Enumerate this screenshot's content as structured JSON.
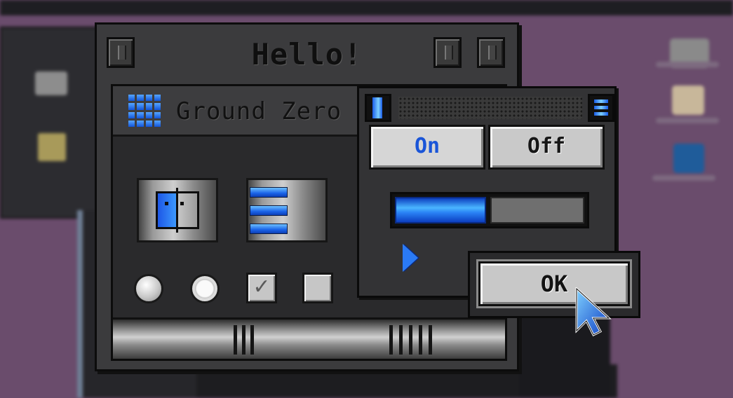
{
  "hello_window": {
    "title": "Hello!"
  },
  "inner_panel": {
    "title": "Ground Zero C"
  },
  "switch_window": {
    "on_label": "On",
    "off_label": "Off",
    "selected": "On",
    "progress_fraction": 0.48
  },
  "dialog": {
    "ok_label": "OK"
  },
  "checkbox": {
    "checkmark": "✓"
  },
  "icons": {
    "finder": "finder-face-icon",
    "list": "list-icon",
    "grid": "grid-icon",
    "disclosure": "disclosure-triangle-icon",
    "cursor": "arrow-cursor-icon"
  },
  "colors": {
    "accent_blue": "#2a7af5",
    "desktop": "#6a4c6c",
    "window": "#3b3b3d"
  }
}
